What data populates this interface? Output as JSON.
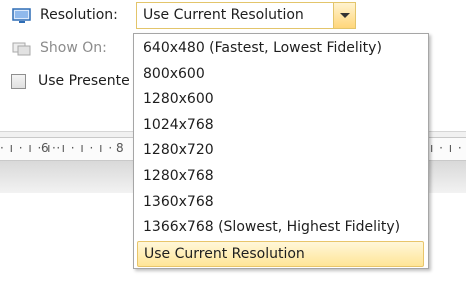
{
  "resolution": {
    "label": "Resolution:",
    "value": "Use Current Resolution",
    "options": [
      "640x480 (Fastest, Lowest Fidelity)",
      "800x600",
      "1280x600",
      "1024x768",
      "1280x720",
      "1280x768",
      "1360x768",
      "1366x768 (Slowest, Highest Fidelity)",
      "Use Current Resolution"
    ],
    "selected_index": 8
  },
  "show_on": {
    "label": "Show On:"
  },
  "presenter": {
    "label": "Use Presente"
  },
  "ruler": {
    "mark_6": "6",
    "mark_8": "8"
  },
  "colors": {
    "accent": "#ffd67a",
    "selection_border": "#e8c56a",
    "icon_blue": "#2f6db5"
  }
}
